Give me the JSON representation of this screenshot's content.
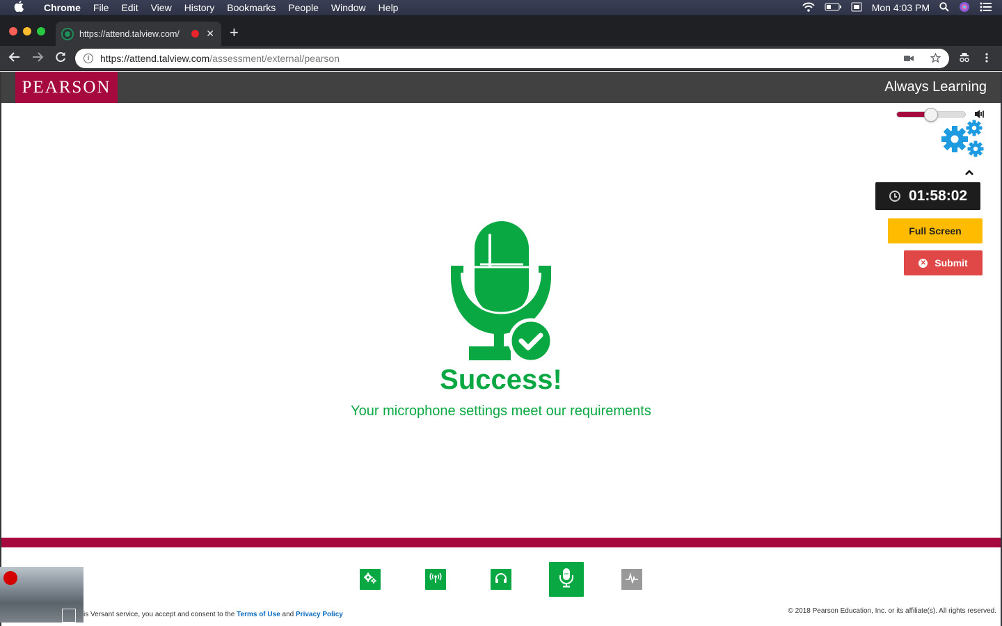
{
  "menubar": {
    "app": "Chrome",
    "items": [
      "File",
      "Edit",
      "View",
      "History",
      "Bookmarks",
      "People",
      "Window",
      "Help"
    ],
    "clock": "Mon 4:03 PM"
  },
  "browser": {
    "tab_title": "https://attend.talview.com/",
    "url_host": "https://attend.talview.com",
    "url_path": "/assessment/external/pearson"
  },
  "header": {
    "logo": "PEARSON",
    "tagline": "Always Learning",
    "brand_color": "#a6093d"
  },
  "controls": {
    "volume_level": 0.5,
    "timer": "01:58:02",
    "fullscreen_label": "Full Screen",
    "submit_label": "Submit"
  },
  "main": {
    "title": "Success!",
    "message": "Your microphone settings meet our requirements",
    "accent_color": "#0aa843"
  },
  "steps": [
    {
      "icon": "settings-icon",
      "state": "done"
    },
    {
      "icon": "connection-icon",
      "state": "done"
    },
    {
      "icon": "headphones-icon",
      "state": "done"
    },
    {
      "icon": "microphone-icon",
      "state": "active"
    },
    {
      "icon": "waveform-icon",
      "state": "pending"
    }
  ],
  "footer": {
    "consent_text": "is Versant service, you accept and consent to the",
    "terms_link": "Terms of Use",
    "and_text": "and",
    "privacy_link": "Privacy Policy",
    "copyright": "© 2018 Pearson Education, Inc. or its affiliate(s). All rights reserved."
  }
}
